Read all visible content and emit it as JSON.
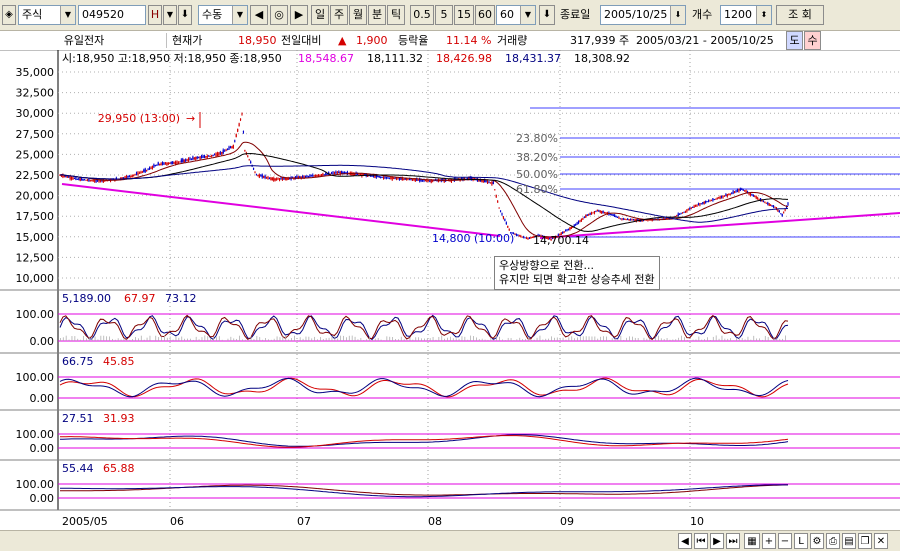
{
  "toolbar": {
    "type_select": "주식",
    "code_input": "049520",
    "h_btn": "H",
    "mode_select": "수동",
    "period_buttons": [
      "일",
      "주",
      "월",
      "분",
      "틱"
    ],
    "interval_buttons": [
      "0.5",
      "5",
      "15",
      "60"
    ],
    "interval_value": "60",
    "end_date_label": "종료일",
    "end_date": "2005/10/25",
    "count_label": "개수",
    "count": "1200",
    "query_button": "조 회"
  },
  "info": {
    "name": "유일전자",
    "price_label": "현재가",
    "price": "18,950",
    "change_label": "전일대비",
    "change_arrow": "▲",
    "change": "1,900",
    "rate_label": "등락율",
    "rate": "11.14 %",
    "volume_label": "거래량",
    "volume": "317,939 주",
    "range": "2005/03/21 - 2005/10/25",
    "btn1": "도",
    "btn2": "수"
  },
  "chart_data": {
    "type": "candlestick",
    "colors": {
      "up": "#d40000",
      "down": "#0000cc",
      "ma": [
        "#000080",
        "#800000",
        "#000000"
      ],
      "fib": "#4040ff",
      "trend": "#e000e0"
    },
    "ohlc_text": "시:18,950 고:18,950 저:18,950 종:18,950",
    "ma_values": [
      "18,548.67",
      "18,111.32",
      "18,426.98",
      "18,431.37",
      "18,308.92"
    ],
    "y_ticks": [
      "35,000",
      "32,500",
      "30,000",
      "27,500",
      "25,000",
      "22,500",
      "20,000",
      "17,500",
      "15,000",
      "12,500",
      "10,000"
    ],
    "ylim": [
      10000,
      35000
    ],
    "x_ticks": [
      "2005/05",
      "06",
      "07",
      "08",
      "09",
      "10"
    ],
    "price_path": [
      [
        0,
        22500
      ],
      [
        3,
        22000
      ],
      [
        6,
        21800
      ],
      [
        9,
        21900
      ],
      [
        12,
        22300
      ],
      [
        15,
        23100
      ],
      [
        17,
        23800
      ],
      [
        20,
        24000
      ],
      [
        23,
        24500
      ],
      [
        26,
        24800
      ],
      [
        28,
        25200
      ],
      [
        30,
        26000
      ],
      [
        31.5,
        29950
      ],
      [
        32,
        25500
      ],
      [
        34,
        22500
      ],
      [
        37,
        22000
      ],
      [
        40,
        22100
      ],
      [
        44,
        22400
      ],
      [
        48,
        22800
      ],
      [
        52,
        22600
      ],
      [
        56,
        22200
      ],
      [
        60,
        22000
      ],
      [
        64,
        21800
      ],
      [
        68,
        21900
      ],
      [
        71,
        22100
      ],
      [
        73,
        21800
      ],
      [
        75,
        21500
      ],
      [
        76,
        18500
      ],
      [
        78,
        15500
      ],
      [
        80,
        15000
      ],
      [
        81,
        14800
      ],
      [
        83,
        15200
      ],
      [
        85,
        14700
      ],
      [
        87,
        15500
      ],
      [
        89,
        16300
      ],
      [
        91,
        17500
      ],
      [
        93,
        18200
      ],
      [
        95,
        17800
      ],
      [
        97,
        17200
      ],
      [
        100,
        17000
      ],
      [
        103,
        17100
      ],
      [
        106,
        17300
      ],
      [
        108,
        18000
      ],
      [
        110,
        18800
      ],
      [
        113,
        19500
      ],
      [
        116,
        20200
      ],
      [
        118,
        20800
      ],
      [
        120,
        20000
      ],
      [
        122,
        19200
      ],
      [
        124,
        18500
      ],
      [
        125,
        17600
      ],
      [
        126,
        18950
      ]
    ],
    "max_label": "29,950 (13:00)",
    "min_label1": "14,800 (10:00)",
    "min_label2": "14,700.14",
    "fib_labels": [
      "23.80%",
      "38.20%",
      "50.00%",
      "61.80%"
    ],
    "annotation_lines": [
      "우상방향으로 전환...",
      "유지만 되면 확고한 상승추세 전환"
    ],
    "indicators": [
      {
        "values": [
          "5,189.00",
          "67.97",
          "73.12"
        ],
        "ticks": [
          "100.00",
          "0.00"
        ]
      },
      {
        "values": [
          "66.75",
          "45.85"
        ],
        "ticks": [
          "100.00",
          "0.00"
        ]
      },
      {
        "values": [
          "27.51",
          "31.93"
        ],
        "ticks": [
          "100.00",
          "0.00"
        ]
      },
      {
        "values": [
          "55.44",
          "65.88"
        ],
        "ticks": [
          "100.00",
          "0.00"
        ]
      }
    ]
  }
}
